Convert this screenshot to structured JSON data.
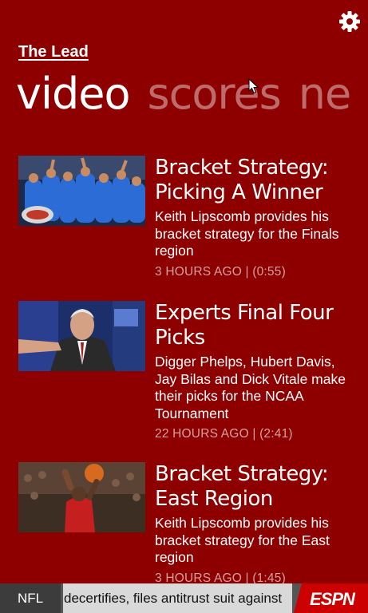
{
  "header": {
    "app_title": "The Lead",
    "settings_icon": "gear-icon"
  },
  "pivots": [
    {
      "label": "video",
      "active": true
    },
    {
      "label": "scores",
      "active": false
    },
    {
      "label": "ne",
      "active": false
    }
  ],
  "videos": [
    {
      "title": "Bracket Strategy: Picking A Winner",
      "description": "Keith Lipscomb provides his bracket strategy for the Finals region",
      "meta": "3 HOURS AGO | (0:55)"
    },
    {
      "title": "Experts Final Four Picks",
      "description": "Digger Phelps, Hubert Davis, Jay Bilas and Dick Vitale make their picks for the NCAA Tournament",
      "meta": "22 HOURS AGO | (2:41)"
    },
    {
      "title": "Bracket Strategy: East Region",
      "description": "Keith Lipscomb provides his bracket strategy for the East region",
      "meta": "3 HOURS AGO | (1:45)"
    }
  ],
  "ticker": {
    "category": "NFL",
    "text": "decertifies, files antitrust suit against"
  },
  "brand": {
    "logo_text": "ESPN",
    "background": "#8e0000",
    "logo_color": "#cc0000"
  }
}
